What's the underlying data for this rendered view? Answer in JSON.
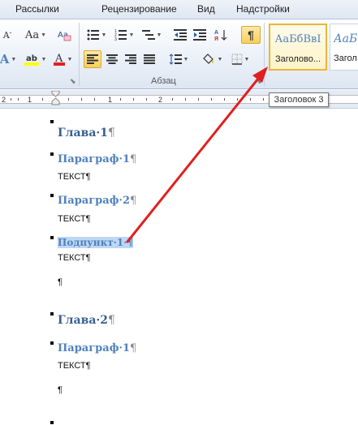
{
  "tabs": [
    "Рассылки",
    "Рецензирование",
    "Вид",
    "Надстройки"
  ],
  "ribbon": {
    "paragraph_group_label": "Абзац",
    "show_marks_glyph": "¶",
    "font_size_case_label": "Aa",
    "styles": [
      {
        "sample": "АаБбВвI",
        "name": "Заголово..."
      },
      {
        "sample": "АаБб",
        "name": "Загол"
      }
    ]
  },
  "tooltip": "Заголовок 3",
  "ruler": {
    "numbers": [
      "2",
      "1",
      "1",
      "2"
    ]
  },
  "document": {
    "paragraphs": [
      {
        "text": "Глава·1",
        "mark": "¶",
        "style": "h1"
      },
      {
        "text": "Параграф·1",
        "mark": "¶",
        "style": "h2"
      },
      {
        "text": "ТЕКСТ",
        "mark": "¶",
        "style": "body"
      },
      {
        "text": "Параграф·2",
        "mark": "¶",
        "style": "h2"
      },
      {
        "text": "ТЕКСТ",
        "mark": "¶",
        "style": "body"
      },
      {
        "text": "Подпункт·1·¶",
        "mark": "",
        "style": "h3"
      },
      {
        "text": "ТЕКСТ",
        "mark": "¶",
        "style": "body"
      },
      {
        "text": "",
        "mark": "¶",
        "style": "body"
      },
      {
        "text": "Глава·2",
        "mark": "¶",
        "style": "h1"
      },
      {
        "text": "Параграф·1",
        "mark": "¶",
        "style": "h2"
      },
      {
        "text": "ТЕКСТ",
        "mark": "¶",
        "style": "body"
      },
      {
        "text": "",
        "mark": "¶",
        "style": "body"
      }
    ]
  },
  "colors": {
    "heading1": "#365f91",
    "heading2": "#4f81bd",
    "selection": "#bdd7f4",
    "arrow": "#e02020",
    "active_button": "#f9cf5a"
  }
}
